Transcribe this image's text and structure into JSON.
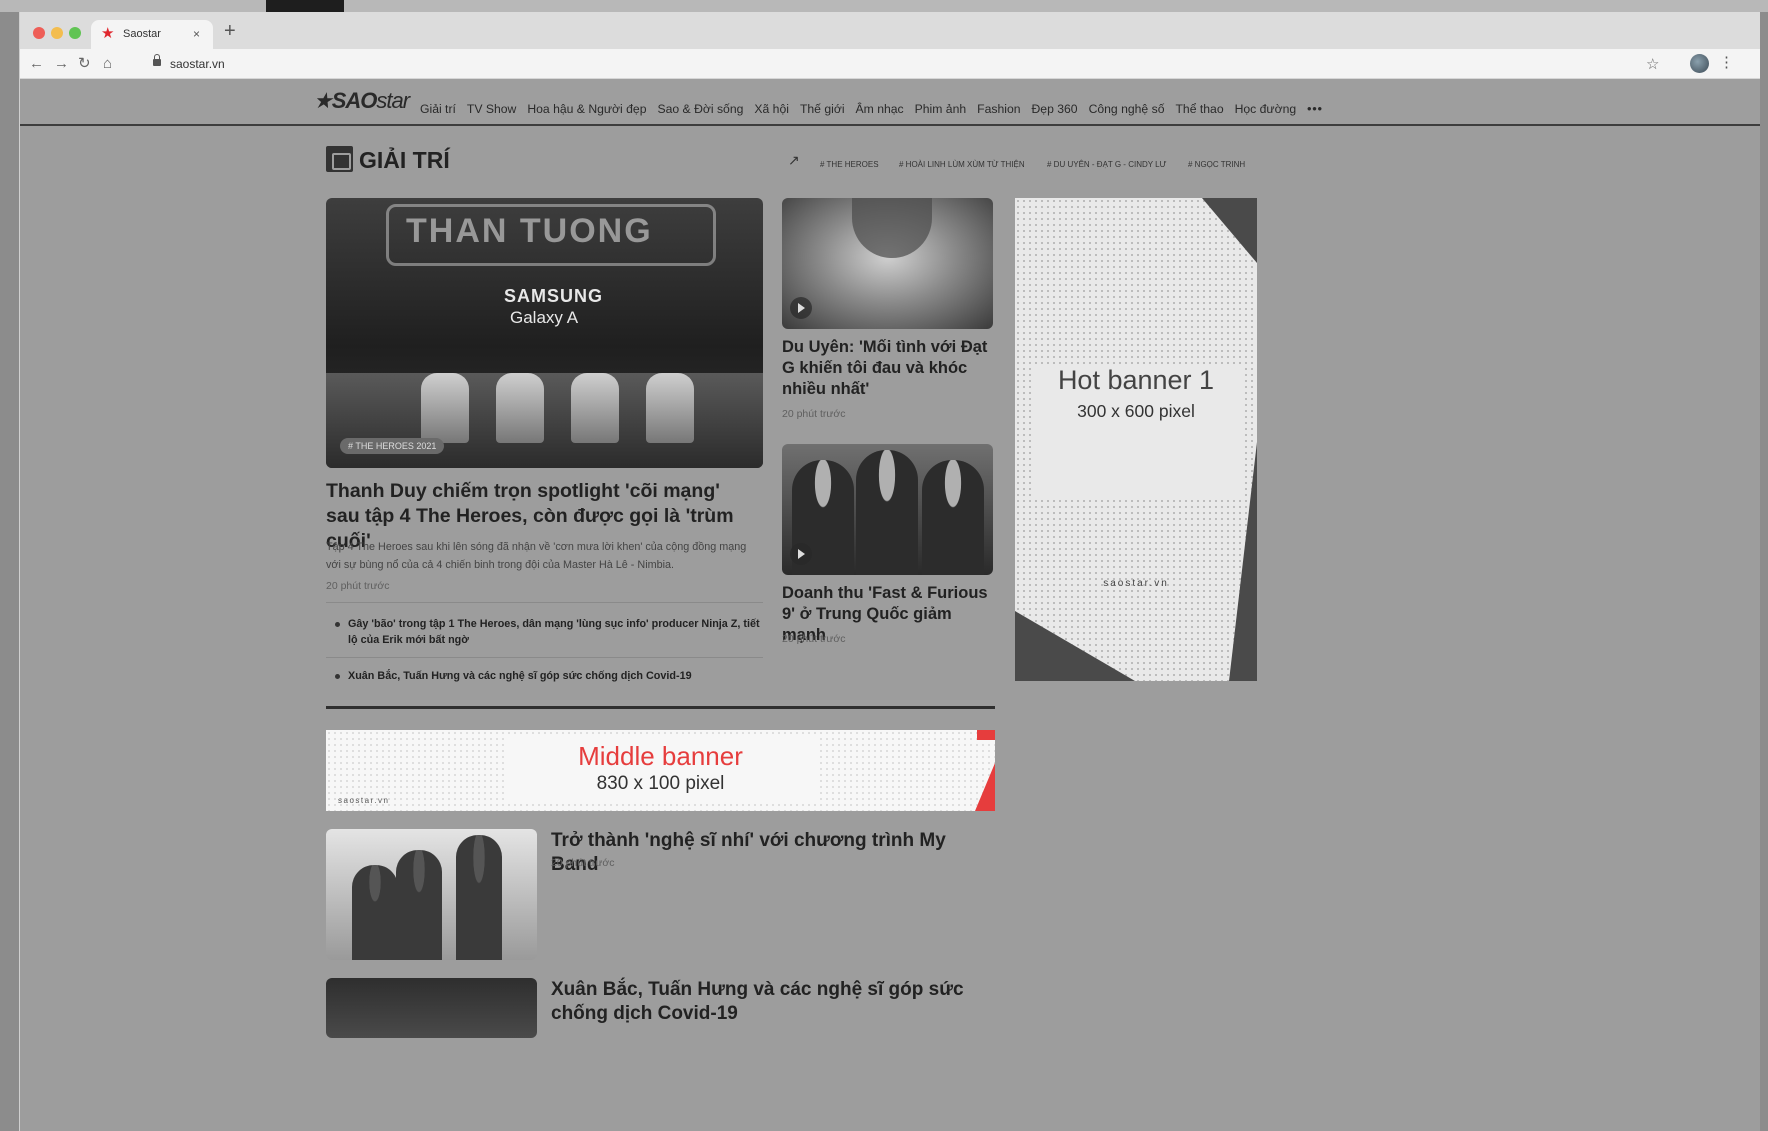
{
  "browser": {
    "tab_title": "Saostar",
    "tab_close": "×",
    "new_tab": "+",
    "url": "saostar.vn",
    "icons": [
      "back-icon",
      "forward-icon",
      "reload-icon",
      "home-icon",
      "lock-icon",
      "star-icon",
      "kebab-icon"
    ]
  },
  "header": {
    "logo_bold": "SAO",
    "logo_light": "star",
    "nav": [
      "Giải trí",
      "TV Show",
      "Hoa hậu & Người đẹp",
      "Sao & Đời sống",
      "Xã hội",
      "Thế giới",
      "Âm nhạc",
      "Phim ảnh",
      "Fashion",
      "Đẹp 360",
      "Công nghệ số",
      "Thể thao",
      "Học đường"
    ],
    "more": "•••"
  },
  "section": {
    "title": "GIẢI TRÍ",
    "tags": [
      "# THE HEROES",
      "# HOÀI LINH LÙM XÙM TỪ THIỆN",
      "# DU UYÊN - ĐẠT G - CINDY LƯ",
      "# NGỌC TRINH"
    ]
  },
  "feature": {
    "image_tag": "# THE HEROES 2021",
    "image_brand": "SAMSUNG",
    "image_sub": "Galaxy A",
    "image_sign": "THAN TUONG DOI THAN TUONG",
    "title": "Thanh Duy chiếm trọn spotlight 'cõi mạng' sau tập 4 The Heroes, còn được gọi là 'trùm cuối'",
    "summary": "Tập 4 The Heroes sau khi lên sóng đã nhận về 'cơn mưa lời khen' của cộng đồng mạng với sự bùng nổ của cả 4 chiến binh trong đội của Master Hà Lê - Nimbia.",
    "time": "20 phút trước",
    "related": [
      "Gây 'bão' trong tập 1 The Heroes, dân mạng 'lùng sục info' producer Ninja Z, tiết lộ của Erik mới bất ngờ",
      "Xuân Bắc, Tuấn Hưng và các nghệ sĩ góp sức chống dịch Covid-19"
    ]
  },
  "side_articles": [
    {
      "title": "Du Uyên: 'Mối tình với Đạt G khiến tôi đau và khóc nhiều nhất'",
      "time": "20 phút trước"
    },
    {
      "title": "Doanh thu 'Fast & Furious 9' ở Trung Quốc giảm mạnh",
      "time": "20 phút trước"
    }
  ],
  "hot_banner": {
    "title": "Hot banner 1",
    "size": "300 x 600 pixel",
    "brand": "saostar.vn"
  },
  "middle_banner": {
    "title": "Middle banner",
    "size": "830 x 100 pixel",
    "brand": "saostar.vn",
    "accent": "#e63d3d"
  },
  "list_articles": [
    {
      "title": "Trở thành 'nghệ sĩ nhí' với chương trình My Band",
      "time": "20 phút trước"
    },
    {
      "title": "Xuân Bắc, Tuấn Hưng và các nghệ sĩ góp sức chống dịch Covid-19"
    }
  ]
}
